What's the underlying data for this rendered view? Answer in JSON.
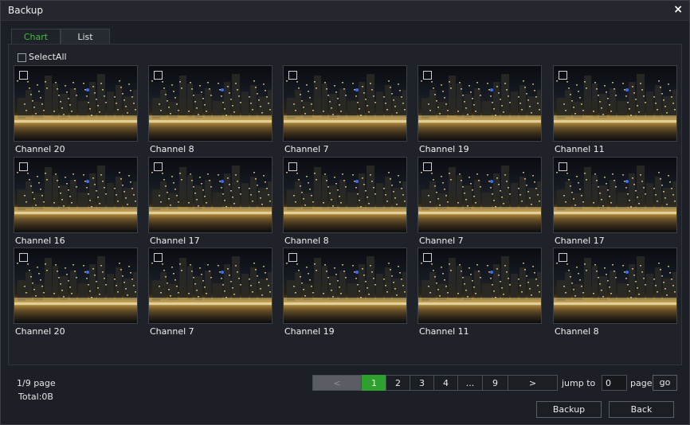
{
  "window": {
    "title": "Backup",
    "close_icon": "×"
  },
  "tabs": [
    {
      "label": "Chart",
      "active": true
    },
    {
      "label": "List",
      "active": false
    }
  ],
  "select_all_label": "SelectAll",
  "channels": [
    "Channel 20",
    "Channel 8",
    "Channel 7",
    "Channel 19",
    "Channel 11",
    "Channel 16",
    "Channel 17",
    "Channel 8",
    "Channel 7",
    "Channel 17",
    "Channel 20",
    "Channel 7",
    "Channel 19",
    "Channel 11",
    "Channel 8"
  ],
  "pagination": {
    "page_info": "1/9 page",
    "total": "Total:0B",
    "prev": "<",
    "pages": [
      "1",
      "2",
      "3",
      "4",
      "...",
      "9"
    ],
    "next": ">",
    "current": "1",
    "jump_to_label": "jump to",
    "jump_value": "0",
    "page_label": "page",
    "go_label": "go"
  },
  "actions": {
    "backup_label": "Backup",
    "back_label": "Back"
  },
  "colors": {
    "accent": "#2da02d",
    "tab_active_text": "#3bbf3b"
  }
}
